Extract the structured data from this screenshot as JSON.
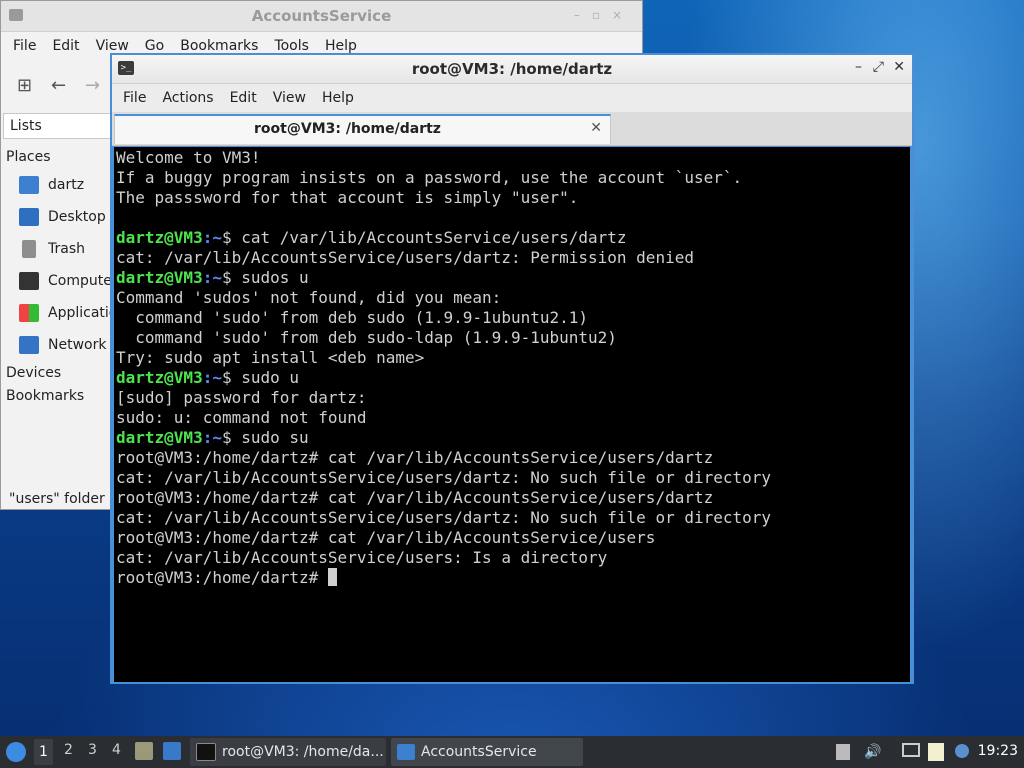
{
  "file_manager": {
    "title": "AccountsService",
    "menu": [
      "File",
      "Edit",
      "View",
      "Go",
      "Bookmarks",
      "Tools",
      "Help"
    ],
    "sidebar_header": "Lists",
    "places_label": "Places",
    "places": [
      "dartz",
      "Desktop",
      "Trash",
      "Compute",
      "Applicatio",
      "Network"
    ],
    "devices_label": "Devices",
    "bookmarks_label": "Bookmarks",
    "status": "\"users\" folder"
  },
  "terminal": {
    "title": "root@VM3: /home/dartz",
    "menu": [
      "File",
      "Actions",
      "Edit",
      "View",
      "Help"
    ],
    "tab_label": "root@VM3: /home/dartz",
    "lines": [
      {
        "text": "Welcome to VM3!"
      },
      {
        "text": "If a buggy program insists on a password, use the account `user`."
      },
      {
        "text": "The passsword for that account is simply \"user\"."
      },
      {
        "text": ""
      },
      {
        "user": "dartz@VM3",
        "path": ":~",
        "text": "$ cat /var/lib/AccountsService/users/dartz"
      },
      {
        "text": "cat: /var/lib/AccountsService/users/dartz: Permission denied"
      },
      {
        "user": "dartz@VM3",
        "path": ":~",
        "text": "$ sudos u"
      },
      {
        "text": "Command 'sudos' not found, did you mean:"
      },
      {
        "text": "  command 'sudo' from deb sudo (1.9.9-1ubuntu2.1)"
      },
      {
        "text": "  command 'sudo' from deb sudo-ldap (1.9.9-1ubuntu2)"
      },
      {
        "text": "Try: sudo apt install <deb name>"
      },
      {
        "user": "dartz@VM3",
        "path": ":~",
        "text": "$ sudo u"
      },
      {
        "text": "[sudo] password for dartz:"
      },
      {
        "text": "sudo: u: command not found"
      },
      {
        "user": "dartz@VM3",
        "path": ":~",
        "text": "$ sudo su"
      },
      {
        "text": "root@VM3:/home/dartz# cat /var/lib/AccountsService/users/dartz"
      },
      {
        "text": "cat: /var/lib/AccountsService/users/dartz: No such file or directory"
      },
      {
        "text": "root@VM3:/home/dartz# cat /var/lib/AccountsService/users/dartz"
      },
      {
        "text": "cat: /var/lib/AccountsService/users/dartz: No such file or directory"
      },
      {
        "text": "root@VM3:/home/dartz# cat /var/lib/AccountsService/users"
      },
      {
        "text": "cat: /var/lib/AccountsService/users: Is a directory"
      },
      {
        "text": "root@VM3:/home/dartz# ",
        "cursor": true
      }
    ]
  },
  "taskbar": {
    "workspaces": [
      "1",
      "2",
      "3",
      "4"
    ],
    "tasks": [
      "root@VM3: /home/da...",
      "AccountsService"
    ],
    "clock": "19:23"
  }
}
